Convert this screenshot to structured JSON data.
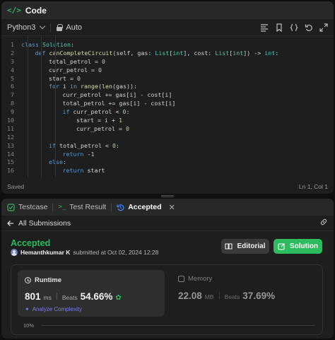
{
  "code_panel": {
    "tab_title": "Code",
    "language": "Python3",
    "mode": "Auto",
    "status": "Saved",
    "cursor": "Ln 1, Col 1",
    "lines": [
      {
        "n": "1",
        "indent": 0,
        "tokens": [
          [
            "kw",
            "class "
          ],
          [
            "cls",
            "Solution"
          ],
          [
            "",
            ":"
          ]
        ]
      },
      {
        "n": "2",
        "indent": 1,
        "tokens": [
          [
            "kw",
            "def "
          ],
          [
            "fn",
            "canCompleteCircuit"
          ],
          [
            "",
            "(self, gas: "
          ],
          [
            "cls",
            "List"
          ],
          [
            "",
            "["
          ],
          [
            "cls",
            "int"
          ],
          [
            "",
            "], cost: "
          ],
          [
            "cls",
            "List"
          ],
          [
            "",
            "["
          ],
          [
            "cls",
            "int"
          ],
          [
            "",
            "]) -> "
          ],
          [
            "cls",
            "int"
          ],
          [
            "",
            ":"
          ]
        ]
      },
      {
        "n": "3",
        "indent": 2,
        "tokens": [
          [
            "",
            "total_petrol = "
          ],
          [
            "num",
            "0"
          ]
        ]
      },
      {
        "n": "4",
        "indent": 2,
        "tokens": [
          [
            "",
            "curr_petrol = "
          ],
          [
            "num",
            "0"
          ]
        ]
      },
      {
        "n": "5",
        "indent": 2,
        "tokens": [
          [
            "",
            "start = "
          ],
          [
            "num",
            "0"
          ]
        ]
      },
      {
        "n": "6",
        "indent": 2,
        "tokens": [
          [
            "kw",
            "for "
          ],
          [
            "",
            "i "
          ],
          [
            "kw",
            "in "
          ],
          [
            "fn",
            "range"
          ],
          [
            "",
            "("
          ],
          [
            "fn",
            "len"
          ],
          [
            "",
            "(gas)):"
          ]
        ]
      },
      {
        "n": "7",
        "indent": 3,
        "tokens": [
          [
            "",
            "curr_petrol += gas[i] - cost[i]"
          ]
        ]
      },
      {
        "n": "8",
        "indent": 3,
        "tokens": [
          [
            "",
            "total_petrol += gas[i] - cost[i]"
          ]
        ]
      },
      {
        "n": "9",
        "indent": 3,
        "tokens": [
          [
            "kw",
            "if "
          ],
          [
            "",
            "curr_petrol < "
          ],
          [
            "num",
            "0"
          ],
          [
            "",
            ":"
          ]
        ]
      },
      {
        "n": "10",
        "indent": 4,
        "tokens": [
          [
            "",
            "start = i + "
          ],
          [
            "num",
            "1"
          ]
        ]
      },
      {
        "n": "11",
        "indent": 4,
        "tokens": [
          [
            "",
            "curr_petrol = "
          ],
          [
            "num",
            "0"
          ]
        ]
      },
      {
        "n": "12",
        "indent": 0,
        "tokens": []
      },
      {
        "n": "13",
        "indent": 2,
        "tokens": [
          [
            "kw",
            "if "
          ],
          [
            "",
            "total_petrol < "
          ],
          [
            "num",
            "0"
          ],
          [
            "",
            ":"
          ]
        ]
      },
      {
        "n": "14",
        "indent": 3,
        "tokens": [
          [
            "kw",
            "return "
          ],
          [
            "",
            "-"
          ],
          [
            "num",
            "1"
          ]
        ]
      },
      {
        "n": "15",
        "indent": 2,
        "tokens": [
          [
            "kw",
            "else"
          ],
          [
            "",
            ":"
          ]
        ]
      },
      {
        "n": "16",
        "indent": 3,
        "tokens": [
          [
            "kw",
            "return "
          ],
          [
            "",
            "start"
          ]
        ]
      }
    ]
  },
  "result_panel": {
    "tabs": [
      {
        "label": "Testcase"
      },
      {
        "label": "Test Result"
      },
      {
        "label": "Accepted"
      }
    ],
    "back_label": "All Submissions",
    "status": "Accepted",
    "author": "Hemanthkumar K",
    "submitted_text": "submitted at Oct 02, 2024 12:28",
    "editorial_label": "Editorial",
    "solution_label": "Solution",
    "runtime": {
      "title": "Runtime",
      "value": "801",
      "unit": "ms",
      "beats_label": "Beats",
      "beats_pct": "54.66%",
      "analyze_label": "Analyze Complexity"
    },
    "memory": {
      "title": "Memory",
      "value": "22.08",
      "unit": "MB",
      "beats_label": "Beats",
      "beats_pct": "37.69%"
    },
    "chart_tick": "10%"
  },
  "colors": {
    "accent_green": "#2cbb5d",
    "analyze_purple": "#7b7fe8",
    "code_bg": "#1e1e1e"
  }
}
